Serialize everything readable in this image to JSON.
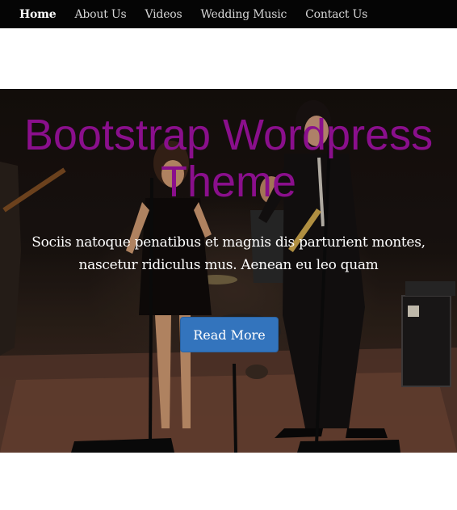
{
  "nav": {
    "items": [
      {
        "label": "Home",
        "active": true
      },
      {
        "label": "About Us",
        "active": false
      },
      {
        "label": "Videos",
        "active": false
      },
      {
        "label": "Wedding Music",
        "active": false
      },
      {
        "label": "Contact Us",
        "active": false
      }
    ]
  },
  "hero": {
    "title": "Bootstrap Wordpress Theme",
    "subtitle": "Sociis natoque penatibus et magnis dis parturient montes, nascetur ridiculus mus. Aenean eu leo quam",
    "button_label": "Read More"
  },
  "colors": {
    "navbar_bg": "#050505",
    "title_color": "#8a0f8c",
    "button_bg": "#3374bd"
  }
}
